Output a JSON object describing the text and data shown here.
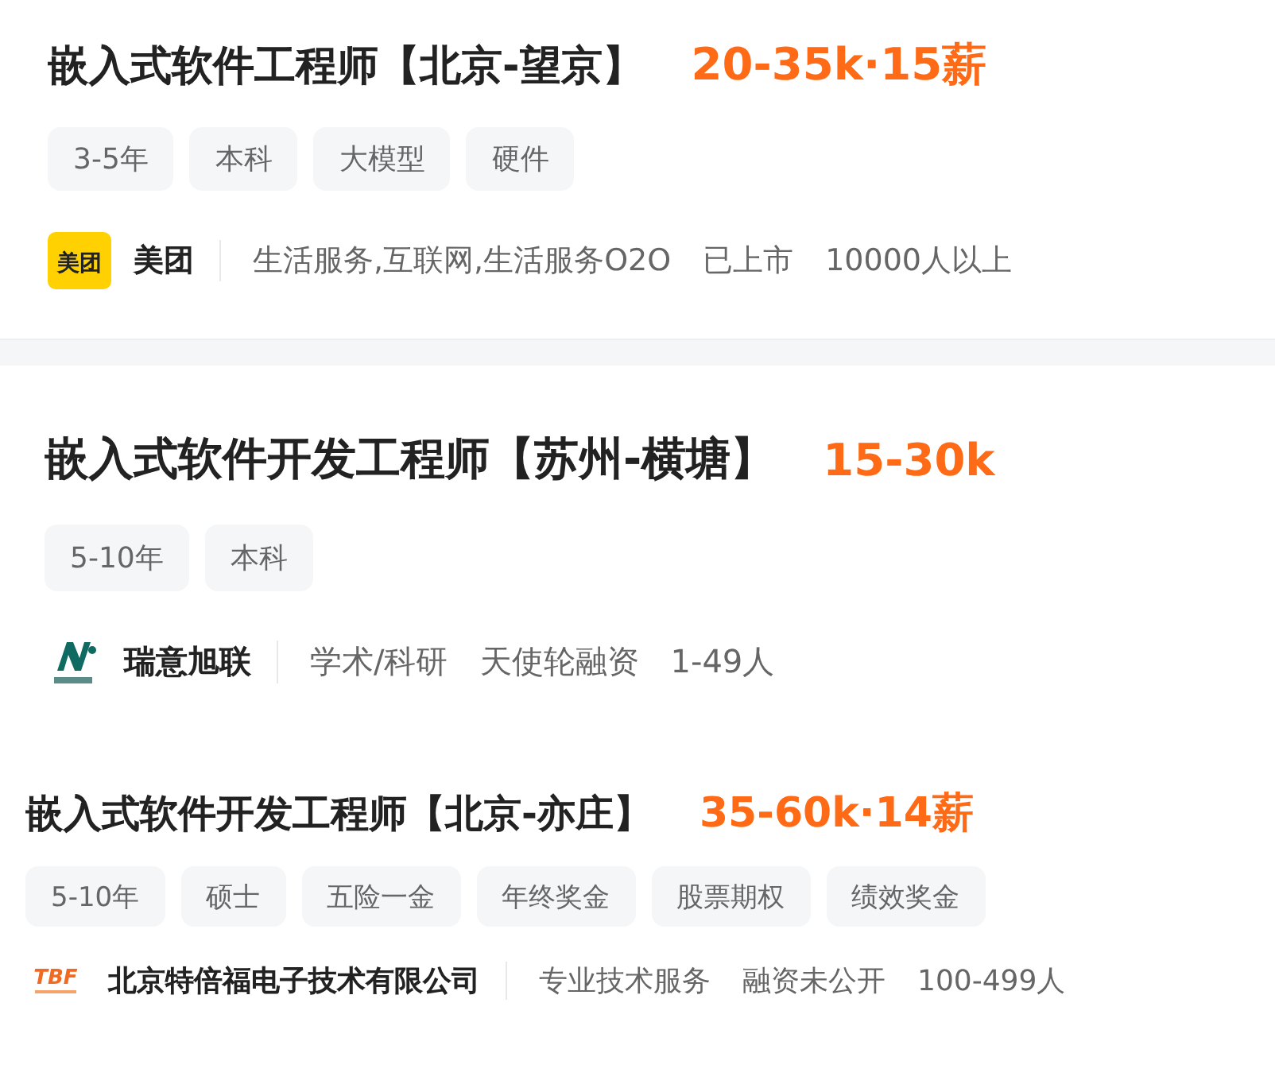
{
  "jobs": [
    {
      "title": "嵌入式软件工程师【北京-望京】",
      "salary": "20-35k·15薪",
      "tags": [
        "3-5年",
        "本科",
        "大模型",
        "硬件"
      ],
      "company": {
        "kind": "meituan",
        "logo_text": "美团",
        "name": "美团",
        "details": [
          "生活服务,互联网,生活服务O2O",
          "已上市",
          "10000人以上"
        ]
      }
    },
    {
      "title": "嵌入式软件开发工程师【苏州-横塘】",
      "salary": "15-30k",
      "tags": [
        "5-10年",
        "本科"
      ],
      "company": {
        "kind": "ruiyi",
        "name": "瑞意旭联",
        "details": [
          "学术/科研",
          "天使轮融资",
          "1-49人"
        ]
      }
    },
    {
      "title": "嵌入式软件开发工程师【北京-亦庄】",
      "salary": "35-60k·14薪",
      "tags": [
        "5-10年",
        "硕士",
        "五险一金",
        "年终奖金",
        "股票期权",
        "绩效奖金"
      ],
      "company": {
        "kind": "tbf",
        "logo_text": "TBF",
        "name": "北京特倍福电子技术有限公司",
        "details": [
          "专业技术服务",
          "融资未公开",
          "100-499人"
        ]
      }
    }
  ]
}
